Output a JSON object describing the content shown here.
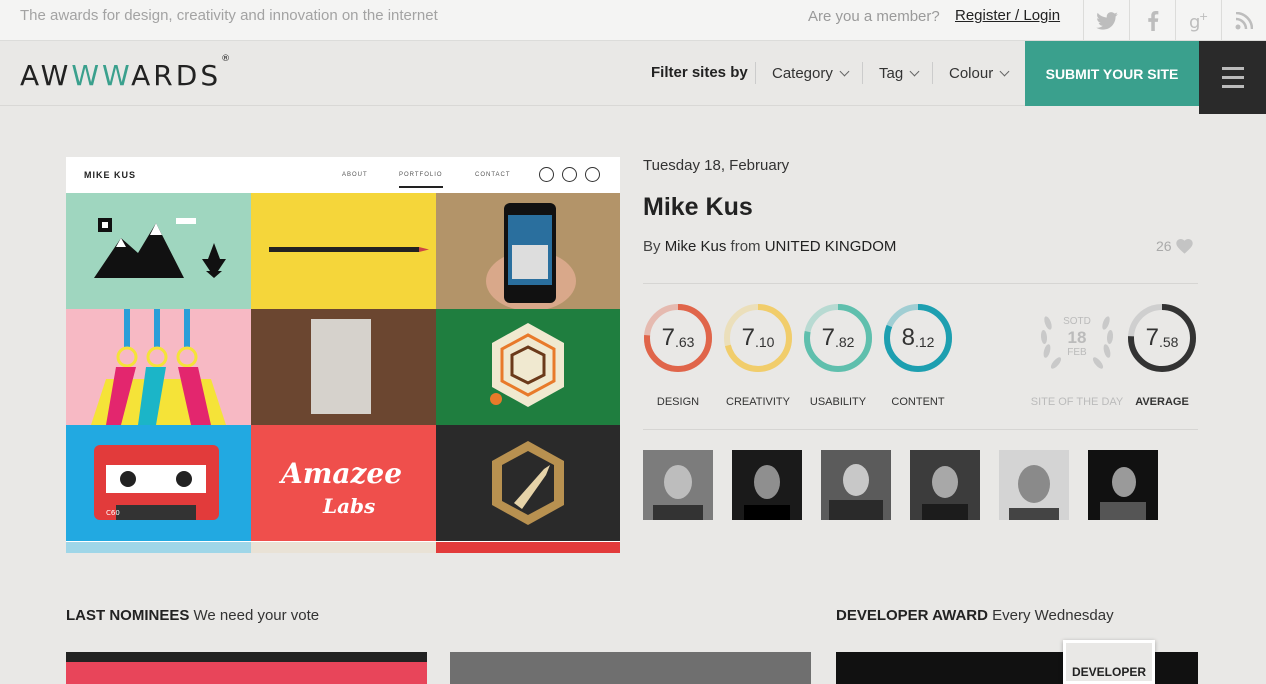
{
  "topbar": {
    "tagline": "The awards for design, creativity and innovation on the internet",
    "member_question": "Are you a member?",
    "login_label": "Register / Login",
    "social": [
      "twitter-icon",
      "facebook-icon",
      "google-plus-icon",
      "rss-icon"
    ]
  },
  "header": {
    "logo_a": "AW",
    "logo_ww": "WW",
    "logo_b": "ARDS",
    "logo_reg": "®",
    "filter_label": "Filter sites by",
    "filters": [
      "Category",
      "Tag",
      "Colour"
    ],
    "submit_label": "SUBMIT YOUR SITE"
  },
  "preview": {
    "site_name": "MIKE KUS",
    "nav": [
      "ABOUT",
      "PORTFOLIO",
      "CONTACT"
    ],
    "active_nav": "PORTFOLIO",
    "tiles": [
      {
        "bg": "#9fd6bf"
      },
      {
        "bg": "#f5d63a"
      },
      {
        "bg": "#b39469"
      },
      {
        "bg": "#f7b9c4"
      },
      {
        "bg": "#6b4630"
      },
      {
        "bg": "#1f7e3f"
      },
      {
        "bg": "#22a9e1"
      },
      {
        "bg": "#ef4f4c"
      },
      {
        "bg": "#2a2a2a"
      }
    ],
    "tile_texts": {
      "amazee": "Amazee",
      "labs": "Labs",
      "cassette": "C60"
    }
  },
  "site": {
    "date": "Tuesday 18, February",
    "title": "Mike Kus",
    "by": "By",
    "author": "Mike Kus",
    "from": "from",
    "country": "UNITED KINGDOM",
    "likes": "26"
  },
  "scores": [
    {
      "label": "DESIGN",
      "int": "7",
      "dec": ".63",
      "value": 7.63,
      "color": "#e0654a"
    },
    {
      "label": "CREATIVITY",
      "int": "7",
      "dec": ".10",
      "value": 7.1,
      "color": "#f1cd6b"
    },
    {
      "label": "USABILITY",
      "int": "7",
      "dec": ".82",
      "value": 7.82,
      "color": "#5fbfad"
    },
    {
      "label": "CONTENT",
      "int": "8",
      "dec": ".12",
      "value": 8.12,
      "color": "#1d9fb0"
    }
  ],
  "sotd": {
    "top": "SOTD",
    "day": "18",
    "month": "FEB",
    "label": "SITE OF THE DAY"
  },
  "average": {
    "int": "7",
    "dec": ".58",
    "value": 7.58,
    "label": "AVERAGE",
    "color": "#333333"
  },
  "jury": [
    "jury-photo-1",
    "jury-photo-2",
    "jury-photo-3",
    "jury-photo-4",
    "jury-photo-5",
    "jury-photo-6"
  ],
  "nominees": {
    "title": "LAST NOMINEES",
    "subtitle": "We need your vote"
  },
  "developer": {
    "title": "DEVELOPER AWARD",
    "subtitle": "Every Wednesday",
    "badge": "DEVELOPER"
  }
}
